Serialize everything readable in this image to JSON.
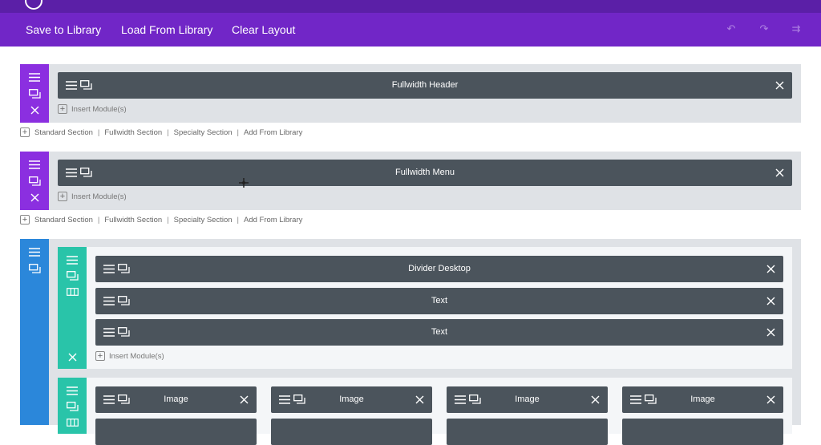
{
  "toolbar": {
    "save_label": "Save to Library",
    "load_label": "Load From Library",
    "clear_label": "Clear Layout",
    "icons": [
      "undo-icon",
      "redo-icon",
      "history-icon"
    ]
  },
  "sections": [
    {
      "module": "Fullwidth Header",
      "insert": "Insert Module(s)"
    },
    {
      "module": "Fullwidth Menu",
      "insert": "Insert Module(s)"
    }
  ],
  "section_links": {
    "standard": "Standard Section",
    "fullwidth": "Fullwidth Section",
    "specialty": "Specialty Section",
    "library": "Add From Library",
    "separator": "|"
  },
  "row1": {
    "modules": [
      "Divider Desktop",
      "Text",
      "Text"
    ],
    "insert": "Insert Module(s)"
  },
  "row2": {
    "modules": [
      "Image",
      "Image",
      "Image",
      "Image"
    ]
  },
  "colors": {
    "topbar": "#5b1fa7",
    "toolbar": "#7126c7",
    "fullwidth_section": "#8b2fe0",
    "regular_section": "#2b87da",
    "row": "#29c4a9",
    "module": "#4b545c",
    "section_bg": "#dfe2e6"
  }
}
